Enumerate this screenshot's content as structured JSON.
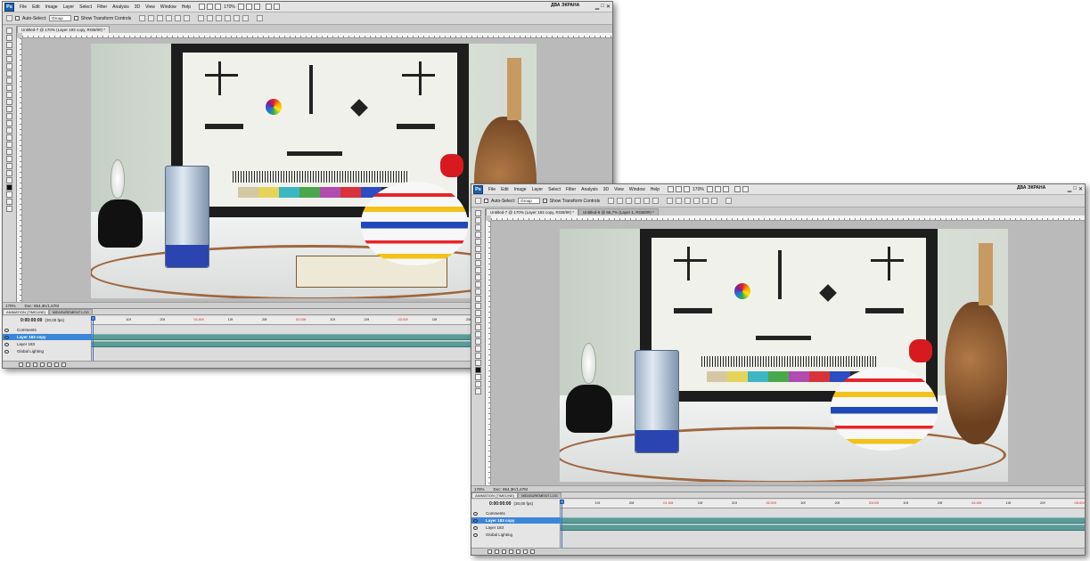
{
  "app": {
    "logo": "Ps"
  },
  "menu": [
    "File",
    "Edit",
    "Image",
    "Layer",
    "Select",
    "Filter",
    "Analysis",
    "3D",
    "View",
    "Window",
    "Help"
  ],
  "workspace_label": "ДВА ЭКРАНА",
  "zoom_menu_value": "170%",
  "options_bar": {
    "auto_select_label": "Auto-Select:",
    "auto_select_value": "Group",
    "transform_label": "Show Transform Controls"
  },
  "window1": {
    "tabs": [
      {
        "label": "Untitled-7 @ 170% (Layer 183 copy, RGB/8#) *",
        "active": true
      }
    ],
    "status_zoom": "170%",
    "status_doc": "Doc: 854,3K/1,67M"
  },
  "window2": {
    "tabs": [
      {
        "label": "Untitled-7 @ 170% (Layer 183 copy, RGB/8#) *",
        "active": true
      },
      {
        "label": "Untitled-6 @ 66,7% (Layer 1, RGB/8#) *",
        "active": false
      }
    ],
    "status_zoom": "170%",
    "status_doc": "Doc: 854,3K/1,67M"
  },
  "animation_panel": {
    "tabs": [
      "ANIMATION (TIMELINE)",
      "MEASUREMENT LOG"
    ],
    "current_time": "0:00:00:00",
    "fps": "(30,00 fps)",
    "ruler_ticks": [
      {
        "label": "10f",
        "red": false
      },
      {
        "label": "20f",
        "red": false
      },
      {
        "label": "01:00f",
        "red": true
      },
      {
        "label": "10f",
        "red": false
      },
      {
        "label": "20f",
        "red": false
      },
      {
        "label": "02:00f",
        "red": true
      },
      {
        "label": "10f",
        "red": false
      },
      {
        "label": "20f",
        "red": false
      },
      {
        "label": "03:00f",
        "red": true
      },
      {
        "label": "10f",
        "red": false
      },
      {
        "label": "20f",
        "red": false
      },
      {
        "label": "04:00f",
        "red": true
      },
      {
        "label": "10f",
        "red": false
      },
      {
        "label": "20f",
        "red": false
      },
      {
        "label": "05:00f",
        "red": true
      }
    ],
    "layers": [
      {
        "label": "Comments",
        "active": false,
        "track": false
      },
      {
        "label": "Layer 183 copy",
        "active": true,
        "track": true
      },
      {
        "label": "Layer 183",
        "active": false,
        "track": true
      },
      {
        "label": "Global Lighting",
        "active": false,
        "track": false
      }
    ]
  },
  "test_chart": {
    "strip_colors": [
      "#d4c8a2",
      "#e4d45a",
      "#3cb6c4",
      "#4aa84a",
      "#b04bb0",
      "#d8333a",
      "#2c4cc4",
      "#2a2a2a"
    ]
  }
}
